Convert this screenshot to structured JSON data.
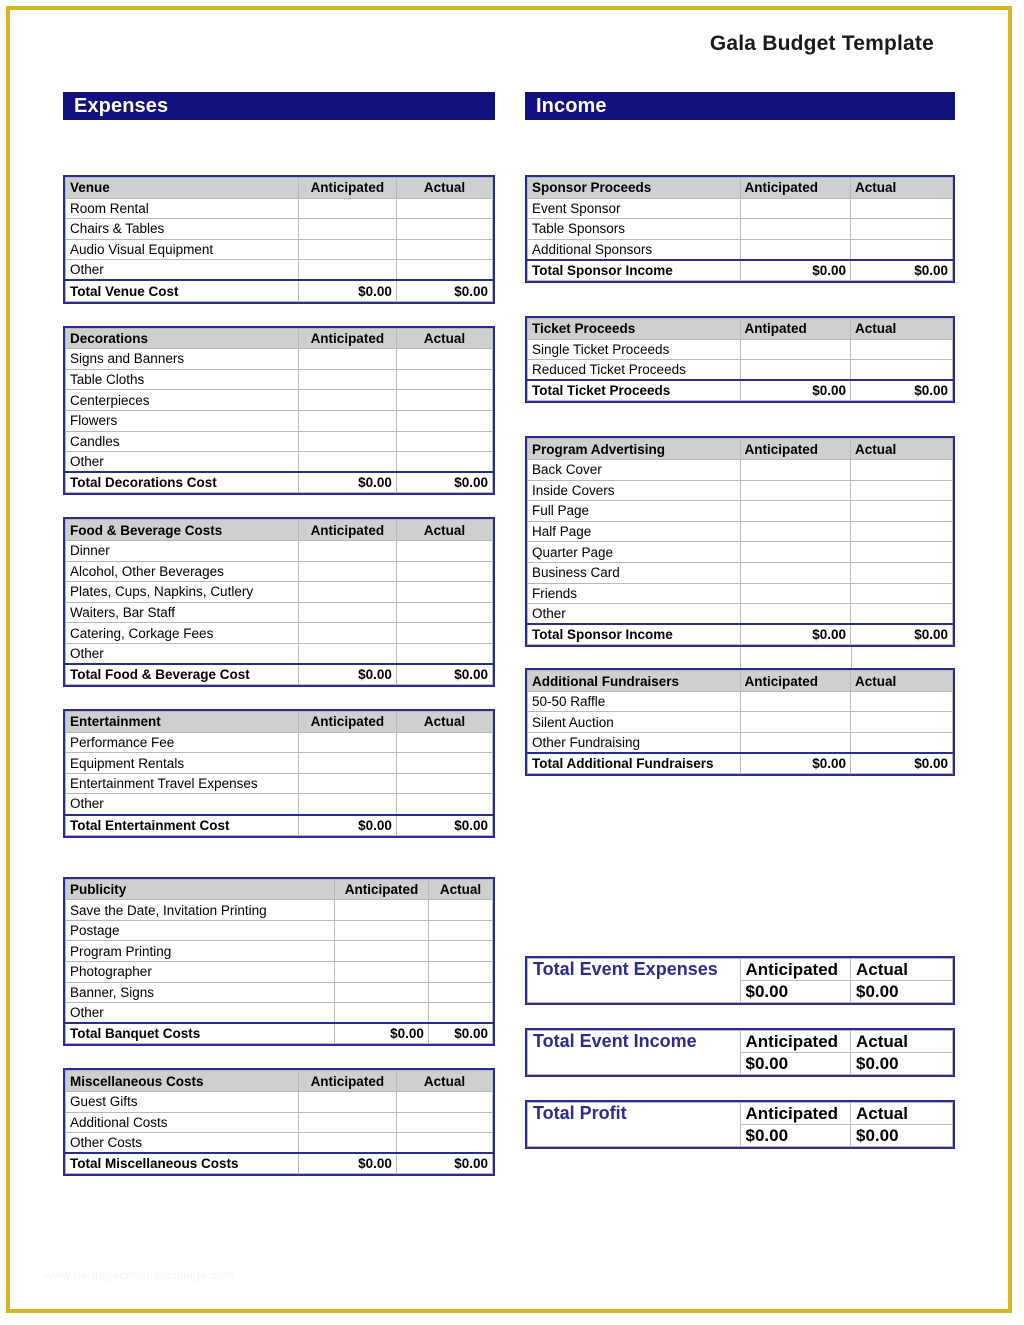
{
  "document": {
    "title": "Gala Budget Template",
    "watermark": "www.heritagechristiancollege.com",
    "accent_navy": "#11117f",
    "accent_border": "#2b2b96",
    "header_gray": "#cfcfcf",
    "page_border_gold": "#d9b320"
  },
  "expenses": {
    "banner": "Expenses",
    "tables": [
      {
        "header": {
          "category": "Venue",
          "anticipated": "Anticipated",
          "actual": "Actual"
        },
        "rows": [
          {
            "label": "Room Rental",
            "anticipated": "",
            "actual": ""
          },
          {
            "label": "Chairs & Tables",
            "anticipated": "",
            "actual": ""
          },
          {
            "label": "Audio Visual Equipment",
            "anticipated": "",
            "actual": ""
          },
          {
            "label": "Other",
            "anticipated": "",
            "actual": ""
          }
        ],
        "total": {
          "label": "Total Venue Cost",
          "anticipated": "$0.00",
          "actual": "$0.00"
        }
      },
      {
        "header": {
          "category": "Decorations",
          "anticipated": "Anticipated",
          "actual": "Actual"
        },
        "rows": [
          {
            "label": "Signs and Banners",
            "anticipated": "",
            "actual": ""
          },
          {
            "label": "Table Cloths",
            "anticipated": "",
            "actual": ""
          },
          {
            "label": "Centerpieces",
            "anticipated": "",
            "actual": ""
          },
          {
            "label": "Flowers",
            "anticipated": "",
            "actual": ""
          },
          {
            "label": "Candles",
            "anticipated": "",
            "actual": ""
          },
          {
            "label": "Other",
            "anticipated": "",
            "actual": ""
          }
        ],
        "total": {
          "label": "Total Decorations Cost",
          "anticipated": "$0.00",
          "actual": "$0.00"
        }
      },
      {
        "header": {
          "category": "Food & Beverage Costs",
          "anticipated": "Anticipated",
          "actual": "Actual"
        },
        "rows": [
          {
            "label": "Dinner",
            "anticipated": "",
            "actual": ""
          },
          {
            "label": "Alcohol, Other Beverages",
            "anticipated": "",
            "actual": ""
          },
          {
            "label": "Plates, Cups, Napkins, Cutlery",
            "anticipated": "",
            "actual": ""
          },
          {
            "label": "Waiters, Bar Staff",
            "anticipated": "",
            "actual": ""
          },
          {
            "label": "Catering, Corkage Fees",
            "anticipated": "",
            "actual": ""
          },
          {
            "label": "Other",
            "anticipated": "",
            "actual": ""
          }
        ],
        "total": {
          "label": "Total Food & Beverage Cost",
          "anticipated": "$0.00",
          "actual": "$0.00"
        }
      },
      {
        "header": {
          "category": "Entertainment",
          "anticipated": "Anticipated",
          "actual": "Actual"
        },
        "rows": [
          {
            "label": "Performance Fee",
            "anticipated": "",
            "actual": ""
          },
          {
            "label": "Equipment Rentals",
            "anticipated": "",
            "actual": ""
          },
          {
            "label": "Entertainment Travel Expenses",
            "anticipated": "",
            "actual": ""
          },
          {
            "label": "Other",
            "anticipated": "",
            "actual": ""
          }
        ],
        "total": {
          "label": "Total Entertainment Cost",
          "anticipated": "$0.00",
          "actual": "$0.00"
        }
      },
      {
        "header": {
          "category": "Publicity",
          "anticipated": "Anticipated",
          "actual": "Actual"
        },
        "rows": [
          {
            "label": "Save the Date, Invitation Printing",
            "anticipated": "",
            "actual": ""
          },
          {
            "label": "Postage",
            "anticipated": "",
            "actual": ""
          },
          {
            "label": "Program Printing",
            "anticipated": "",
            "actual": ""
          },
          {
            "label": "Photographer",
            "anticipated": "",
            "actual": ""
          },
          {
            "label": "Banner, Signs",
            "anticipated": "",
            "actual": ""
          },
          {
            "label": "Other",
            "anticipated": "",
            "actual": ""
          }
        ],
        "total": {
          "label": "Total Banquet Costs",
          "anticipated": "$0.00",
          "actual": "$0.00"
        }
      },
      {
        "header": {
          "category": "Miscellaneous Costs",
          "anticipated": "Anticipated",
          "actual": "Actual"
        },
        "rows": [
          {
            "label": "Guest Gifts",
            "anticipated": "",
            "actual": ""
          },
          {
            "label": "Additional Costs",
            "anticipated": "",
            "actual": ""
          },
          {
            "label": "Other Costs",
            "anticipated": "",
            "actual": ""
          }
        ],
        "total": {
          "label": "Total Miscellaneous Costs",
          "anticipated": "$0.00",
          "actual": "$0.00"
        }
      }
    ]
  },
  "income": {
    "banner": "Income",
    "tables": [
      {
        "header": {
          "category": "Sponsor Proceeds",
          "anticipated": "Anticipated",
          "actual": "Actual"
        },
        "rows": [
          {
            "label": "Event Sponsor",
            "anticipated": "",
            "actual": ""
          },
          {
            "label": "Table Sponsors",
            "anticipated": "",
            "actual": ""
          },
          {
            "label": "Additional Sponsors",
            "anticipated": "",
            "actual": ""
          }
        ],
        "total": {
          "label": "Total Sponsor Income",
          "anticipated": "$0.00",
          "actual": "$0.00"
        }
      },
      {
        "header": {
          "category": "Ticket Proceeds",
          "anticipated": "Antipated",
          "actual": "Actual"
        },
        "rows": [
          {
            "label": "Single Ticket Proceeds",
            "anticipated": "",
            "actual": ""
          },
          {
            "label": "Reduced Ticket Proceeds",
            "anticipated": "",
            "actual": ""
          }
        ],
        "total": {
          "label": "Total Ticket Proceeds",
          "anticipated": "$0.00",
          "actual": "$0.00"
        }
      },
      {
        "header": {
          "category": "Program Advertising",
          "anticipated": "Anticipated",
          "actual": "Actual"
        },
        "rows": [
          {
            "label": "Back Cover",
            "anticipated": "",
            "actual": ""
          },
          {
            "label": "Inside Covers",
            "anticipated": "",
            "actual": ""
          },
          {
            "label": "Full Page",
            "anticipated": "",
            "actual": ""
          },
          {
            "label": "Half Page",
            "anticipated": "",
            "actual": ""
          },
          {
            "label": "Quarter Page",
            "anticipated": "",
            "actual": ""
          },
          {
            "label": "Business Card",
            "anticipated": "",
            "actual": ""
          },
          {
            "label": "Friends",
            "anticipated": "",
            "actual": ""
          },
          {
            "label": "Other",
            "anticipated": "",
            "actual": ""
          }
        ],
        "total": {
          "label": "Total Sponsor Income",
          "anticipated": "$0.00",
          "actual": "$0.00"
        }
      },
      {
        "header": {
          "category": "Additional Fundraisers",
          "anticipated": "Anticipated",
          "actual": "Actual"
        },
        "rows": [
          {
            "label": "50-50 Raffle",
            "anticipated": "",
            "actual": ""
          },
          {
            "label": "Silent Auction",
            "anticipated": "",
            "actual": ""
          },
          {
            "label": "Other Fundraising",
            "anticipated": "",
            "actual": ""
          }
        ],
        "total": {
          "label": "Total Additional Fundraisers",
          "anticipated": "$0.00",
          "actual": "$0.00"
        }
      }
    ],
    "summaries": [
      {
        "label": "Total Event Expenses",
        "anticipated_header": "Anticipated",
        "actual_header": "Actual",
        "anticipated_value": "$0.00",
        "actual_value": "$0.00"
      },
      {
        "label": "Total Event Income",
        "anticipated_header": "Anticipated",
        "actual_header": "Actual",
        "anticipated_value": "$0.00",
        "actual_value": "$0.00"
      },
      {
        "label": "Total Profit",
        "anticipated_header": "Anticipated",
        "actual_header": "Actual",
        "anticipated_value": "$0.00",
        "actual_value": "$0.00"
      }
    ]
  }
}
